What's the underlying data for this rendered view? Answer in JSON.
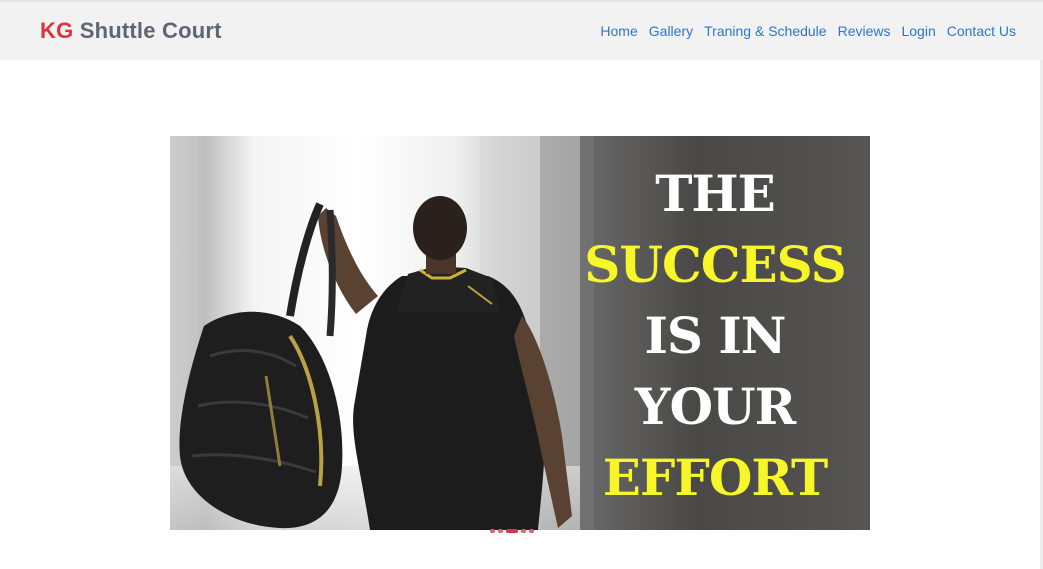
{
  "brand": {
    "kg": "KG",
    "name": "Shuttle Court"
  },
  "nav": [
    {
      "label": "Home"
    },
    {
      "label": "Gallery"
    },
    {
      "label": "Traning & Schedule"
    },
    {
      "label": "Reviews"
    },
    {
      "label": "Login"
    },
    {
      "label": "Contact Us"
    }
  ],
  "slide": {
    "lines": [
      "THE",
      "SUCCESS",
      "IS IN",
      "YOUR",
      "EFFORT"
    ],
    "colors": {
      "white": "#ffffff",
      "yellow": "#f6f628"
    }
  },
  "carousel": {
    "slide_count": 5,
    "active_index": 2
  },
  "colors": {
    "brand_red": "#e0313f",
    "brand_gray": "#5e6670",
    "link_blue": "#2f74d0",
    "navbar_bg": "#f2f2f2"
  }
}
